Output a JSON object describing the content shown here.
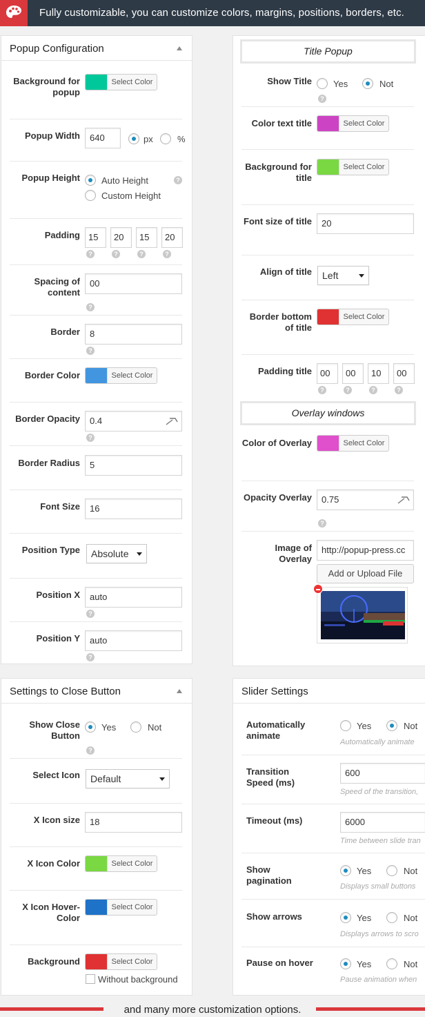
{
  "banner": {
    "text": "Fully customizable, you can customize colors, margins, positions, borders, etc."
  },
  "footer": {
    "text": "and many more customization options."
  },
  "common": {
    "select_color": "Select Color",
    "help": "?"
  },
  "popup_config": {
    "title": "Popup Configuration",
    "bg_label": "Background for popup",
    "bg_color": "#00c89a",
    "width_label": "Popup Width",
    "width_value": "640",
    "unit_px": "px",
    "unit_pct": "%",
    "height_label": "Popup Height",
    "height_auto": "Auto Height",
    "height_custom": "Custom Height",
    "padding_label": "Padding",
    "padding": [
      "15",
      "20",
      "15",
      "20"
    ],
    "spacing_label": "Spacing of content",
    "spacing_value": "00",
    "border_label": "Border",
    "border_value": "8",
    "border_color_label": "Border Color",
    "border_color": "#4296e0",
    "border_opacity_label": "Border Opacity",
    "border_opacity_value": "0.4",
    "border_radius_label": "Border Radius",
    "border_radius_value": "5",
    "font_size_label": "Font Size",
    "font_size_value": "16",
    "position_type_label": "Position Type",
    "position_type_value": "Absolute",
    "pos_x_label": "Position X",
    "pos_x_value": "auto",
    "pos_y_label": "Position Y",
    "pos_y_value": "auto"
  },
  "title_popup": {
    "section": "Title Popup",
    "show_label": "Show Title",
    "yes": "Yes",
    "not": "Not",
    "color_text_label": "Color text title",
    "color_text": "#cc44c4",
    "bg_label": "Background for title",
    "bg_color": "#7ad843",
    "font_size_label": "Font size of title",
    "font_size_value": "20",
    "align_label": "Align of title",
    "align_value": "Left",
    "border_bottom_label": "Border bottom of title",
    "border_bottom_color": "#e03232",
    "padding_label": "Padding title",
    "padding": [
      "00",
      "00",
      "10",
      "00"
    ]
  },
  "overlay": {
    "section": "Overlay windows",
    "color_label": "Color of Overlay",
    "color": "#e050cc",
    "opacity_label": "Opacity Overlay",
    "opacity_value": "0.75",
    "image_label": "Image of Overlay",
    "image_url": "http://popup-press.cc",
    "upload_label": "Add or Upload File"
  },
  "close_button": {
    "title": "Settings to Close Button",
    "show_label": "Show Close Button",
    "yes": "Yes",
    "not": "Not",
    "icon_label": "Select Icon",
    "icon_value": "Default",
    "size_label": "X Icon size",
    "size_value": "18",
    "color_label": "X Icon Color",
    "color": "#7ad843",
    "hover_label": "X Icon Hover-Color",
    "hover_color": "#1e72c8",
    "bg_label": "Background",
    "bg_color": "#e03232",
    "without_bg": "Without background"
  },
  "slider": {
    "title": "Slider Settings",
    "auto_label": "Automatically animate",
    "auto_desc": "Automatically animate",
    "speed_label": "Transition Speed (ms)",
    "speed_value": "600",
    "speed_desc": "Speed of the transition,",
    "timeout_label": "Timeout (ms)",
    "timeout_value": "6000",
    "timeout_desc": "Time between slide tran",
    "pagination_label": "Show pagination",
    "pagination_desc": "Displays small buttons",
    "arrows_label": "Show arrows",
    "arrows_desc": "Displays arrows to scro",
    "pause_label": "Pause on hover",
    "pause_desc": "Pause animation when",
    "yes": "Yes",
    "not": "Not"
  }
}
